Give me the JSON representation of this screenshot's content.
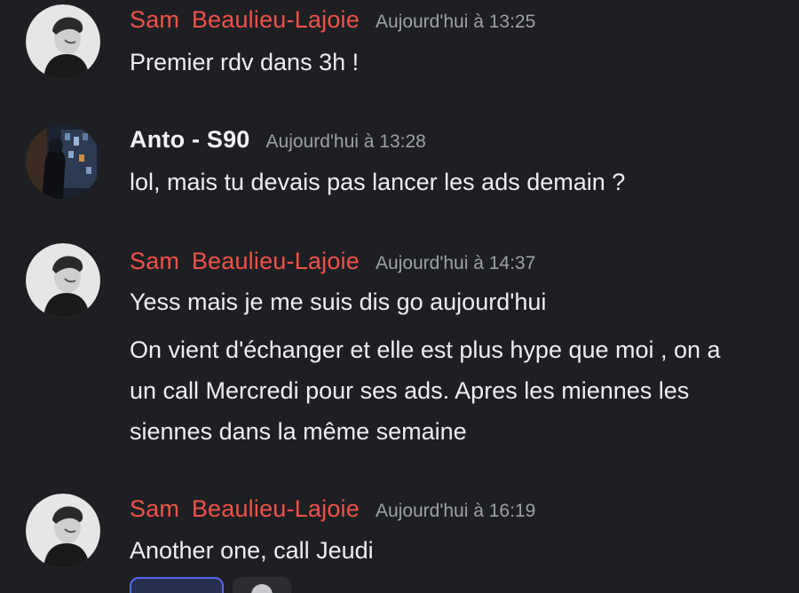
{
  "messages": [
    {
      "author": "Sam  Beaulieu-Lajoie",
      "timestamp": "Aujourd'hui à 13:25",
      "lines": [
        "Premier rdv dans 3h !"
      ]
    },
    {
      "author": "Anto - S90",
      "timestamp": "Aujourd'hui à 13:28",
      "lines": [
        "lol, mais tu devais pas lancer les ads demain ?"
      ]
    },
    {
      "author": "Sam  Beaulieu-Lajoie",
      "timestamp": "Aujourd'hui à 14:37",
      "lines": [
        "Yess mais je me suis dis go aujourd'hui",
        "On vient d'échanger et elle est plus hype que moi , on a un call Mercredi pour ses ads. Apres les miennes les siennes dans la même semaine"
      ]
    },
    {
      "author": "Sam  Beaulieu-Lajoie",
      "timestamp": "Aujourd'hui à 16:19",
      "lines": [
        "Another one, call Jeudi"
      ]
    }
  ],
  "icons": {
    "avatar_sam": "avatar-sam-icon",
    "avatar_anto": "avatar-anto-icon",
    "reaction": "reaction-icon",
    "add_reaction": "add-reaction-icon"
  },
  "colors": {
    "background": "#1e1f22",
    "author_sam": "#f0524a",
    "author_anto": "#f3f4f6",
    "timestamp": "#9ea0a8",
    "reaction_active_border": "#5865f2"
  }
}
